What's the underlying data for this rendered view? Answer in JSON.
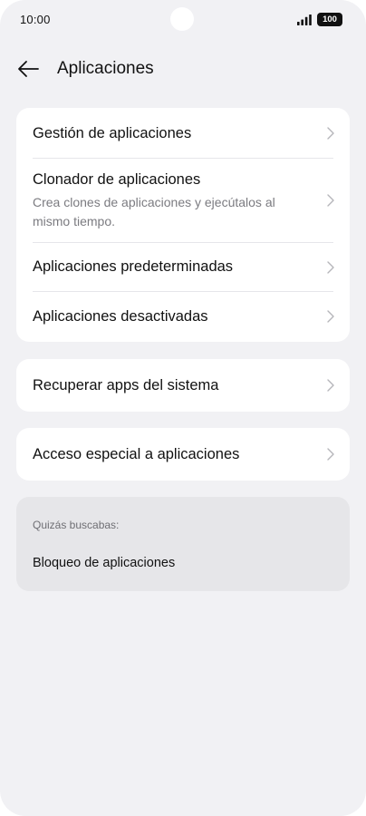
{
  "status_bar": {
    "time": "10:00",
    "battery": "100",
    "signal_icon": "signal-bars-icon",
    "battery_icon": "battery-icon"
  },
  "header": {
    "title": "Aplicaciones",
    "back_icon": "arrow-left-icon"
  },
  "card_main": {
    "items": [
      {
        "label": "Gestión de aplicaciones"
      },
      {
        "label": "Clonador de aplicaciones",
        "subtitle": "Crea clones de aplicaciones y ejecútalos al mismo tiempo."
      },
      {
        "label": "Aplicaciones predeterminadas"
      },
      {
        "label": "Aplicaciones desactivadas"
      }
    ]
  },
  "card_recover": {
    "label": "Recuperar apps del sistema"
  },
  "card_special": {
    "label": "Acceso especial a aplicaciones"
  },
  "suggestions": {
    "heading": "Quizás buscabas:",
    "items": [
      "Bloqueo de aplicaciones"
    ]
  },
  "colors": {
    "background": "#f1f1f4",
    "card": "#ffffff",
    "suggest_card": "#e6e6e9",
    "text_primary": "#111111",
    "text_secondary": "#7b7b80",
    "chevron": "#b5b5ba"
  }
}
